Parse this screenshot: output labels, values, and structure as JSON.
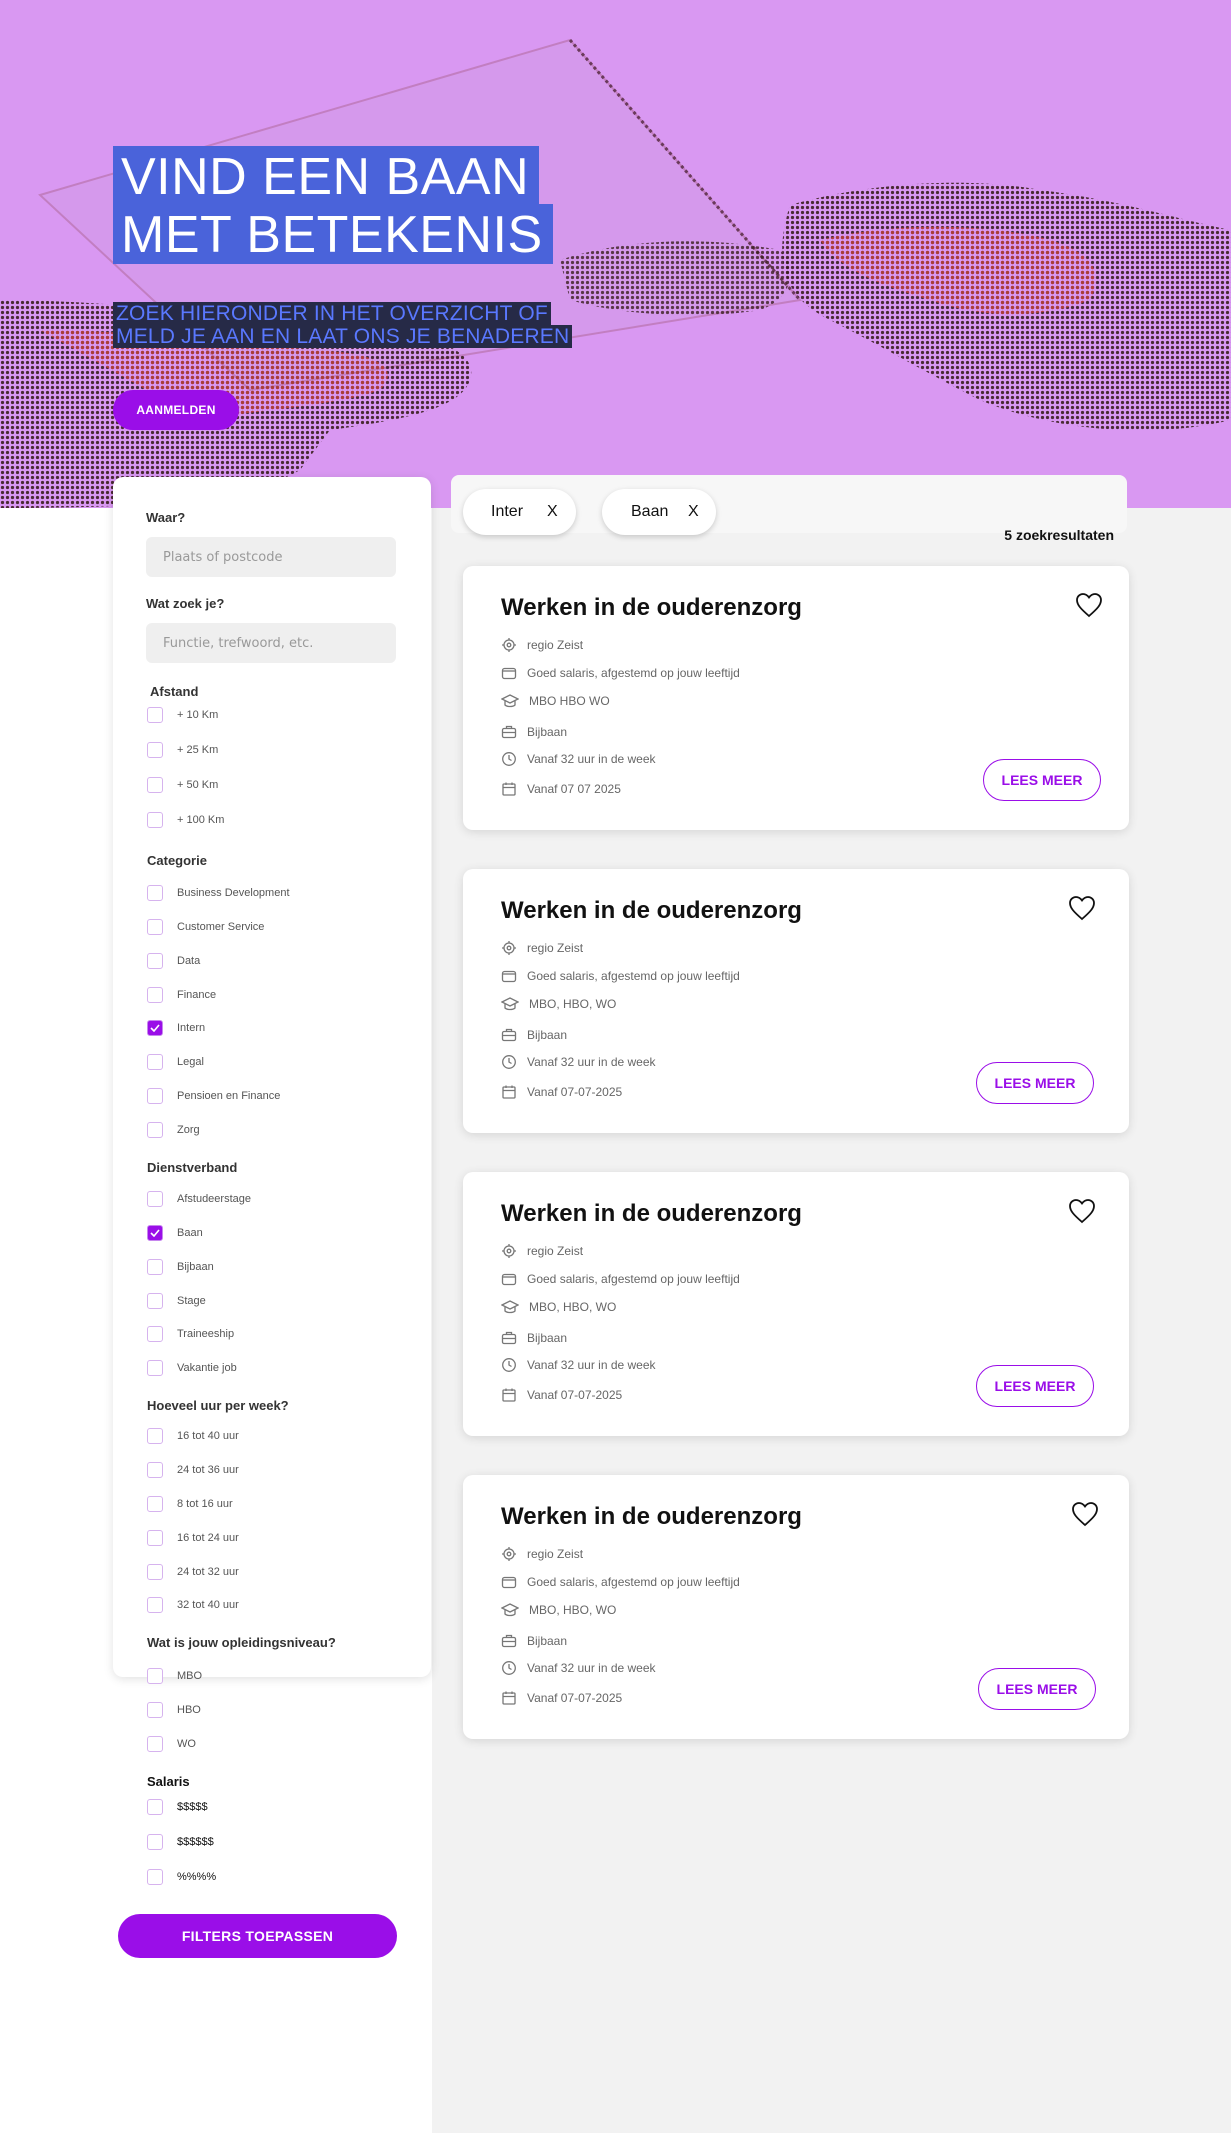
{
  "hero": {
    "title_line1": "VIND EEN BAAN",
    "title_line2": "MET BETEKENIS",
    "subtitle_line1": "ZOEK HIERONDER IN HET OVERZICHT OF",
    "subtitle_line2": "MELD JE AAN EN LAAT ONS JE BENADEREN",
    "register_label": "AANMELDEN",
    "background_color": "#d998f2"
  },
  "filters": {
    "location": {
      "label": "Waar?",
      "placeholder": "Plaats of postcode"
    },
    "query": {
      "label": "Wat zoek je?",
      "placeholder": "Functie, trefwoord, etc."
    },
    "distance": {
      "title": "Afstand",
      "options": [
        {
          "label": "+ 10 Km",
          "checked": false
        },
        {
          "label": "+ 25 Km",
          "checked": false
        },
        {
          "label": "+ 50 Km",
          "checked": false
        },
        {
          "label": "+ 100 Km",
          "checked": false
        }
      ]
    },
    "category": {
      "title": "Categorie",
      "options": [
        {
          "label": "Business Development",
          "checked": false
        },
        {
          "label": "Customer Service",
          "checked": false
        },
        {
          "label": "Data",
          "checked": false
        },
        {
          "label": "Finance",
          "checked": false
        },
        {
          "label": "Intern",
          "checked": true
        },
        {
          "label": "Legal",
          "checked": false
        },
        {
          "label": "Pensioen en Finance",
          "checked": false
        },
        {
          "label": "Zorg",
          "checked": false
        }
      ]
    },
    "employment": {
      "title": "Dienstverband",
      "options": [
        {
          "label": "Afstudeerstage",
          "checked": false
        },
        {
          "label": "Baan",
          "checked": true
        },
        {
          "label": "Bijbaan",
          "checked": false
        },
        {
          "label": "Stage",
          "checked": false
        },
        {
          "label": "Traineeship",
          "checked": false
        },
        {
          "label": "Vakantie job",
          "checked": false
        }
      ]
    },
    "hours": {
      "title": "Hoeveel uur per week?",
      "options": [
        {
          "label": "16 tot 40 uur",
          "checked": false
        },
        {
          "label": "24 tot 36 uur",
          "checked": false
        },
        {
          "label": "8 tot 16 uur",
          "checked": false
        },
        {
          "label": "16 tot 24 uur",
          "checked": false
        },
        {
          "label": "24 tot 32 uur",
          "checked": false
        },
        {
          "label": "32 tot 40 uur",
          "checked": false
        }
      ]
    },
    "education": {
      "title": "Wat is jouw opleidingsniveau?",
      "options": [
        {
          "label": "MBO",
          "checked": false
        },
        {
          "label": "HBO",
          "checked": false
        },
        {
          "label": "WO",
          "checked": false
        }
      ]
    },
    "salary": {
      "title": "Salaris",
      "options": [
        {
          "label": "$$$$$",
          "checked": false
        },
        {
          "label": "$$$$$$",
          "checked": false
        },
        {
          "label": "%%%%",
          "checked": false
        }
      ]
    },
    "apply_label": "FILTERS TOEPASSEN"
  },
  "active_filters": [
    {
      "label": "Inter",
      "remove": "X"
    },
    {
      "label": "Baan",
      "remove": "X"
    }
  ],
  "results_count": "5 zoekresultaten",
  "jobs": [
    {
      "title": "Werken in de ouderenzorg",
      "location": "regio Zeist",
      "salary": "Goed salaris, afgestemd op jouw leeftijd",
      "education": "MBO  HBO  WO",
      "type": "Bijbaan",
      "hours": "Vanaf 32 uur in de week",
      "start": "Vanaf 07  07  2025",
      "cta": "LEES MEER"
    },
    {
      "title": "Werken in de ouderenzorg",
      "location": "regio Zeist",
      "salary": "Goed salaris, afgestemd op jouw leeftijd",
      "education": "MBO, HBO, WO",
      "type": "Bijbaan",
      "hours": "Vanaf 32 uur in de week",
      "start": "Vanaf 07-07-2025",
      "cta": "LEES MEER"
    },
    {
      "title": "Werken in de ouderenzorg",
      "location": "regio Zeist",
      "salary": "Goed salaris, afgestemd op jouw leeftijd",
      "education": "MBO, HBO, WO",
      "type": "Bijbaan",
      "hours": "Vanaf 32 uur in de week",
      "start": "Vanaf 07-07-2025",
      "cta": "LEES MEER"
    },
    {
      "title": "Werken in de ouderenzorg",
      "location": "regio Zeist",
      "salary": "Goed salaris, afgestemd op jouw leeftijd",
      "education": "MBO, HBO, WO",
      "type": "Bijbaan",
      "hours": "Vanaf 32 uur in de week",
      "start": "Vanaf 07-07-2025",
      "cta": "LEES MEER"
    }
  ],
  "colors": {
    "accent": "#9a0ee8",
    "hero": "#d998f2",
    "title_bg": "#4a63da",
    "subtitle_bg": "#262a47"
  },
  "icons": {
    "location": "location-icon",
    "salary": "wallet-icon",
    "education": "graduation-cap-icon",
    "type": "briefcase-icon",
    "hours": "clock-icon",
    "start": "calendar-icon",
    "favorite": "heart-icon"
  }
}
